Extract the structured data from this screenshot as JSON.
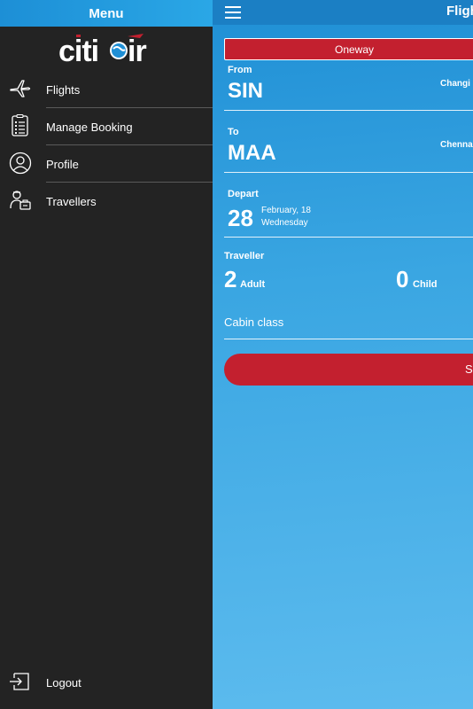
{
  "drawer": {
    "header_title": "Menu",
    "logo_text": "citiair",
    "items": [
      {
        "label": "Flights",
        "icon": "airplane-icon"
      },
      {
        "label": "Manage Booking",
        "icon": "checklist-icon"
      },
      {
        "label": "Profile",
        "icon": "user-circle-icon"
      },
      {
        "label": "Travellers",
        "icon": "traveller-icon"
      }
    ],
    "logout_label": "Logout"
  },
  "topbar": {
    "title": "Flights"
  },
  "form": {
    "trip_type": "Oneway",
    "from_label": "From",
    "from_code": "SIN",
    "from_city": "Changi",
    "to_label": "To",
    "to_code": "MAA",
    "to_city": "Chennai",
    "depart_label": "Depart",
    "depart_day": "28",
    "depart_month_day": "February, 18",
    "depart_weekday": "Wednesday",
    "traveller_label": "Traveller",
    "adult_count": "2",
    "adult_label": "Adult",
    "child_count": "0",
    "child_label": "Child",
    "cabin_label": "Cabin class",
    "search_label": "Search"
  },
  "colors": {
    "brand_red": "#c3202f",
    "brand_blue": "#1f8fd5",
    "drawer_bg": "#232323"
  }
}
